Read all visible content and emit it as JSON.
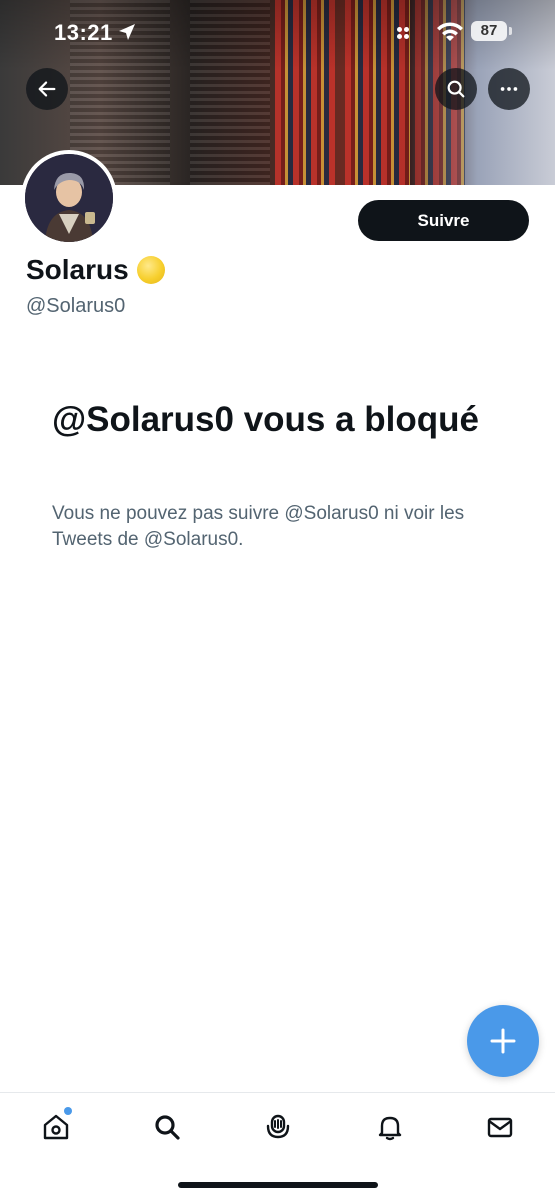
{
  "status_bar": {
    "time": "13:21",
    "battery": "87"
  },
  "banner": {
    "back_icon": "arrow-left-icon",
    "search_icon": "search-icon",
    "more_icon": "more-horizontal-icon"
  },
  "profile": {
    "display_name": "Solarus",
    "emoji": "yellow-circle",
    "handle": "@Solarus0",
    "follow_label": "Suivre"
  },
  "blocked": {
    "title": "@Solarus0 vous a bloqué",
    "description": "Vous ne pouvez pas suivre @Solarus0 ni voir les Tweets de @Solarus0."
  },
  "fab": {
    "icon": "plus-icon"
  },
  "tabbar": {
    "items": [
      {
        "icon": "home-icon",
        "has_notification_dot": true
      },
      {
        "icon": "search-icon"
      },
      {
        "icon": "spaces-icon"
      },
      {
        "icon": "bell-icon"
      },
      {
        "icon": "mail-icon"
      }
    ]
  },
  "colors": {
    "accent": "#4a99e9",
    "text_primary": "#0f1419",
    "text_secondary": "#536471"
  }
}
